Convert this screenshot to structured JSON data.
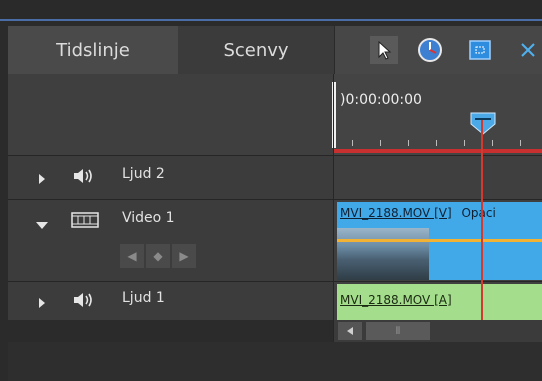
{
  "tabs": [
    {
      "label": "Tidslinje",
      "active": true
    },
    {
      "label": "Scenvy",
      "active": false
    }
  ],
  "toolbar": {
    "icons": [
      "cursor-icon",
      "clock-icon",
      "fit-icon",
      "scissors-icon"
    ]
  },
  "ruler": {
    "timecode": ")0:00:00:00"
  },
  "tracks": [
    {
      "name": "Ljud 2",
      "expanded": false,
      "type": "audio"
    },
    {
      "name": "Video 1",
      "expanded": true,
      "type": "video"
    },
    {
      "name": "Ljud 1",
      "expanded": false,
      "type": "audio"
    }
  ],
  "clips": {
    "video_title": "MVI_2188.MOV [V]",
    "video_effect": "Opaci",
    "audio_title": "MVI_2188.MOV [A]"
  },
  "keyframe_nav": {
    "prev": "◀",
    "add": "◆",
    "next": "▶"
  },
  "scrollbar": {
    "grip": "⦀"
  },
  "colors": {
    "accent": "#4a6da8",
    "video_clip": "#41a9e8",
    "audio_clip": "#a4de8c",
    "playhead": "#d3392f"
  }
}
